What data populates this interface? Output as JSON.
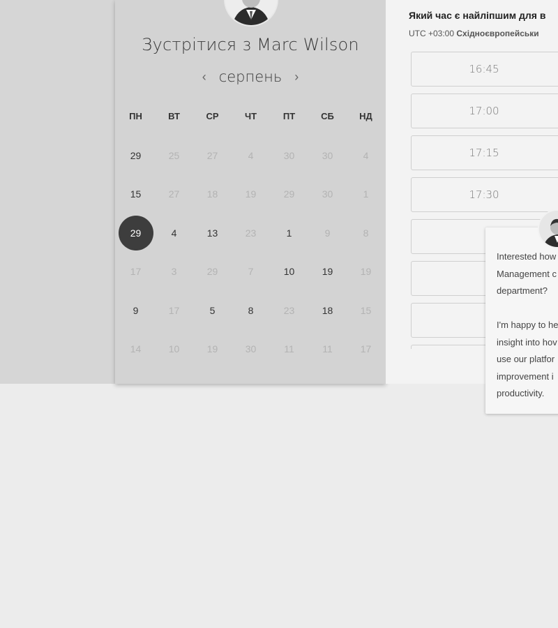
{
  "booking": {
    "title": "Зустрітися з Marc Wilson",
    "month": "серпень",
    "prev_label": "‹",
    "next_label": "›",
    "weekdays": [
      "ПН",
      "ВТ",
      "СР",
      "ЧТ",
      "ПТ",
      "СБ",
      "НД"
    ],
    "weeks": [
      [
        "29",
        "25",
        "27",
        "4",
        "30",
        "30",
        "4"
      ],
      [
        "15",
        "27",
        "18",
        "19",
        "29",
        "30",
        "1"
      ],
      [
        "29",
        "4",
        "13",
        "23",
        "1",
        "9",
        "8"
      ],
      [
        "17",
        "3",
        "29",
        "7",
        "10",
        "19",
        "19"
      ],
      [
        "9",
        "17",
        "5",
        "8",
        "23",
        "18",
        "15"
      ],
      [
        "14",
        "10",
        "19",
        "30",
        "11",
        "11",
        "17"
      ]
    ],
    "active_days": [
      [
        true,
        false,
        false,
        false,
        false,
        false,
        false
      ],
      [
        true,
        false,
        false,
        false,
        false,
        false,
        false
      ],
      [
        true,
        true,
        true,
        false,
        true,
        false,
        false
      ],
      [
        false,
        false,
        false,
        false,
        true,
        true,
        false
      ],
      [
        true,
        false,
        true,
        true,
        false,
        true,
        false
      ],
      [
        false,
        false,
        false,
        false,
        false,
        false,
        false
      ]
    ],
    "selected_day": "29"
  },
  "schedule": {
    "question": "Який час є найліпшим для в",
    "timezone_prefix": "UTC +03:00",
    "timezone_name": "Східноєвропейськи",
    "slots": [
      "16:45",
      "17:00",
      "17:15",
      "17:30",
      "",
      "",
      "",
      ""
    ]
  },
  "chat": {
    "message": "Interested how\nManagement c\ndepartment?\n\nI'm happy to he\ninsight into hov\nuse our platfor\nimprovement i\nproductivity."
  }
}
